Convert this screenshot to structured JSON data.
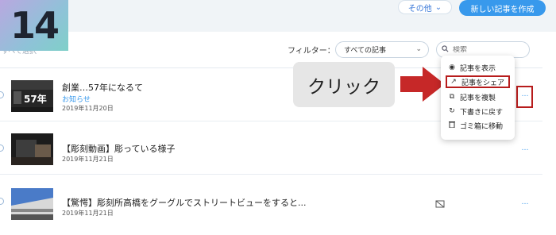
{
  "step": {
    "number": "14"
  },
  "header": {
    "other_label": "その他",
    "other_chevron": "⌄",
    "new_post_label": "新しい記事を作成"
  },
  "filter": {
    "select_all_label": "すべて選択",
    "label": "フィルター：",
    "selected": "すべての記事",
    "chevron": "⌄",
    "search_placeholder": "検索"
  },
  "posts": [
    {
      "title": "創業…57年になるて",
      "category": "お知らせ",
      "date": "2019年11月20日",
      "thumb_text": "57年"
    },
    {
      "title": "【彫刻動画】彫っている様子",
      "category": "",
      "date": "2019年11月21日"
    },
    {
      "title": "【驚愕】彫刻所高橋をグーグルでストリートビューをすると...",
      "category": "",
      "date": "2019年11月21日"
    }
  ],
  "more_label": "…",
  "menu": {
    "items": [
      {
        "label": "記事を表示",
        "icon": "eye-icon",
        "glyph": "◉"
      },
      {
        "label": "記事をシェア",
        "icon": "share-icon",
        "glyph": "↗"
      },
      {
        "label": "記事を複製",
        "icon": "duplicate-icon",
        "glyph": "⧉"
      },
      {
        "label": "下書きに戻す",
        "icon": "revert-icon",
        "glyph": "↻"
      },
      {
        "label": "ゴミ箱に移動",
        "icon": "trash-icon",
        "glyph": "🗑"
      }
    ]
  },
  "callout": {
    "text": "クリック"
  },
  "colors": {
    "accent": "#3899ec",
    "highlight": "#b71c1c",
    "arrow": "#c62828"
  }
}
